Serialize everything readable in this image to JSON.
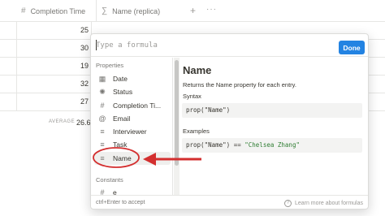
{
  "table": {
    "columns": [
      {
        "icon": "#",
        "label": "Completion Time"
      },
      {
        "icon": "∑",
        "label": "Name (replica)"
      }
    ],
    "add_symbol": "+",
    "more_symbol": "···",
    "rows": [
      "25",
      "30",
      "19",
      "32",
      "27"
    ],
    "average_label": "AVERAGE",
    "average_value": "26.6"
  },
  "formula": {
    "placeholder": "Type a formula",
    "done_label": "Done"
  },
  "sidebar": {
    "properties_label": "Properties",
    "properties": [
      {
        "icon": "calendar-icon",
        "glyph": "▦",
        "label": "Date"
      },
      {
        "icon": "status-icon",
        "glyph": "✺",
        "label": "Status"
      },
      {
        "icon": "number-icon",
        "glyph": "#",
        "label": "Completion Ti..."
      },
      {
        "icon": "email-icon",
        "glyph": "@",
        "label": "Email"
      },
      {
        "icon": "text-icon",
        "glyph": "≡",
        "label": "Interviewer"
      },
      {
        "icon": "text-icon",
        "glyph": "≡",
        "label": "Task"
      },
      {
        "icon": "text-icon",
        "glyph": "≡",
        "label": "Name"
      }
    ],
    "selected_index": 6,
    "constants_label": "Constants",
    "constants": [
      {
        "icon": "number-icon",
        "glyph": "#",
        "label": "e"
      }
    ]
  },
  "detail": {
    "title": "Name",
    "description": "Returns the Name property for each entry.",
    "syntax_label": "Syntax",
    "syntax_code": "prop(\"Name\")",
    "examples_label": "Examples",
    "example_prefix": "prop(\"Name\") == ",
    "example_string": "\"Chelsea Zhang\""
  },
  "footer": {
    "hint": "ctrl+Enter to accept",
    "help_icon": "question-circle-icon",
    "help_link": "Learn more about formulas"
  },
  "annotation": {
    "color": "#d32f2f"
  }
}
